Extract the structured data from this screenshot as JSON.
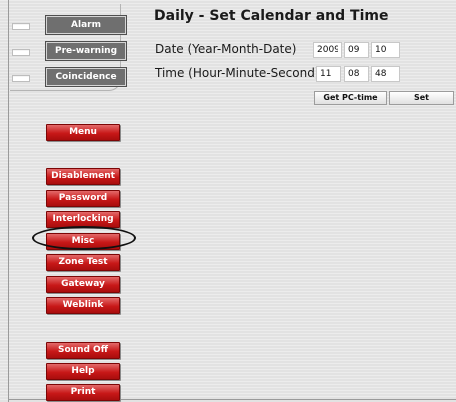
{
  "status": {
    "indicators": [
      {
        "label": "Alarm"
      },
      {
        "label": "Pre-warning"
      },
      {
        "label": "Coincidence"
      }
    ]
  },
  "menu": {
    "items": [
      {
        "label": "Menu"
      },
      {
        "label": "Disablement"
      },
      {
        "label": "Password"
      },
      {
        "label": "Interlocking"
      },
      {
        "label": "Misc",
        "highlighted": true
      },
      {
        "label": "Zone Test"
      },
      {
        "label": "Gateway"
      },
      {
        "label": "Weblink"
      },
      {
        "label": "Sound Off"
      },
      {
        "label": "Help"
      },
      {
        "label": "Print"
      }
    ],
    "button_color": "#c81818"
  },
  "main": {
    "title": "Daily - Set Calendar and Time",
    "date": {
      "label": "Date (Year-Month-Date)",
      "year": "2009",
      "month": "09",
      "day": "10"
    },
    "time": {
      "label": "Time (Hour-Minute-Second)",
      "hour": "11",
      "minute": "08",
      "second": "48"
    },
    "buttons": {
      "get_pc_time": "Get PC-time",
      "set": "Set"
    }
  }
}
